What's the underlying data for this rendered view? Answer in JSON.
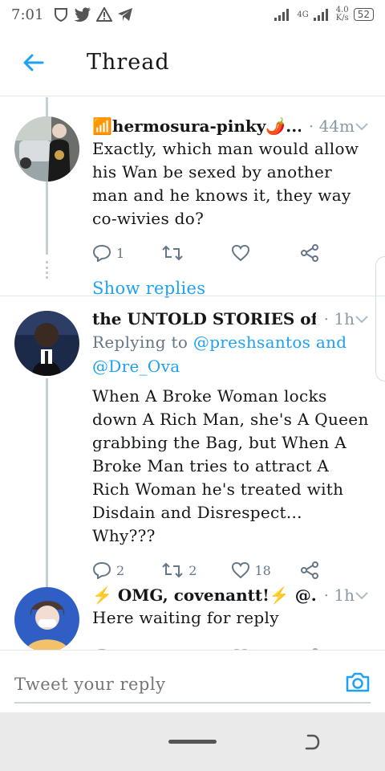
{
  "status_bar": {
    "time": "7:01",
    "network": "4G",
    "speed_value": "4.0",
    "speed_unit": "K/s",
    "battery": "52"
  },
  "header": {
    "title": "Thread"
  },
  "tweets": [
    {
      "name": "📶hermosura-pinky🌶️...",
      "time": "· 44m",
      "text": "Exactly, which man would allow his Wan be sexed by another man and he knows it, they way co-wivies do?",
      "replies": "1",
      "retweets": "",
      "likes": "",
      "show_replies": "Show replies"
    },
    {
      "name": "the UNTOLD STORIES of ...",
      "time": "· 1h",
      "replying_prefix": "Replying to",
      "replying_mentions": "@preshsantos and @Dre_Ova",
      "text": "When A Broke Woman locks down A Rich Man, she's A Queen grabbing the Bag, but When A Broke Man tries to attract A Rich Woman he's treated with Disdain and Disrespect... Why???",
      "replies": "2",
      "retweets": "2",
      "likes": "18"
    },
    {
      "name": "⚡ OMG, covenantt!⚡ @...",
      "time": "· 1h",
      "text": "Here waiting for reply"
    }
  ],
  "composer": {
    "placeholder": "Tweet your reply"
  },
  "colors": {
    "accent": "#1da1f2",
    "text": "#14171a",
    "secondary": "#657786"
  }
}
